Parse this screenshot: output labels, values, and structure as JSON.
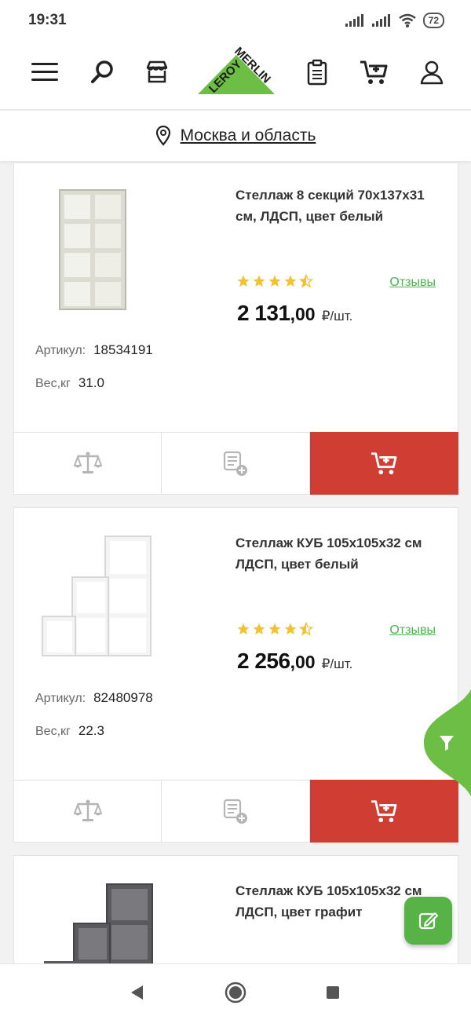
{
  "status_bar": {
    "time": "19:31",
    "battery": "72"
  },
  "header": {
    "logo_line1": "LEROY",
    "logo_line2": "MERLIN",
    "brand_green": "#6cbe45",
    "icons": [
      "menu-icon",
      "search-icon",
      "store-icon",
      "shopping-list-icon",
      "cart-icon",
      "profile-icon"
    ]
  },
  "location": {
    "label": "Москва и область"
  },
  "products": [
    {
      "title": "Стеллаж 8 секций 70x137x31 см, ЛДСП, цвет белый",
      "rating": 4.5,
      "reviews_label": "Отзывы",
      "price_int": "2 131",
      "price_dec": ",00",
      "price_unit": "₽/шт.",
      "article_label": "Артикул:",
      "article": "18534191",
      "weight_label": "Вес,кг",
      "weight": "31.0"
    },
    {
      "title": "Стеллаж КУБ 105x105x32 см ЛДСП, цвет белый",
      "rating": 4.5,
      "reviews_label": "Отзывы",
      "price_int": "2 256",
      "price_dec": ",00",
      "price_unit": "₽/шт.",
      "article_label": "Артикул:",
      "article": "82480978",
      "weight_label": "Вес,кг",
      "weight": "22.3"
    },
    {
      "title": "Стеллаж КУБ 105x105x32 см ЛДСП, цвет графит"
    }
  ],
  "colors": {
    "cart_red": "#cf3d33",
    "link_green": "#48b54d",
    "star_yellow": "#f2c230"
  }
}
